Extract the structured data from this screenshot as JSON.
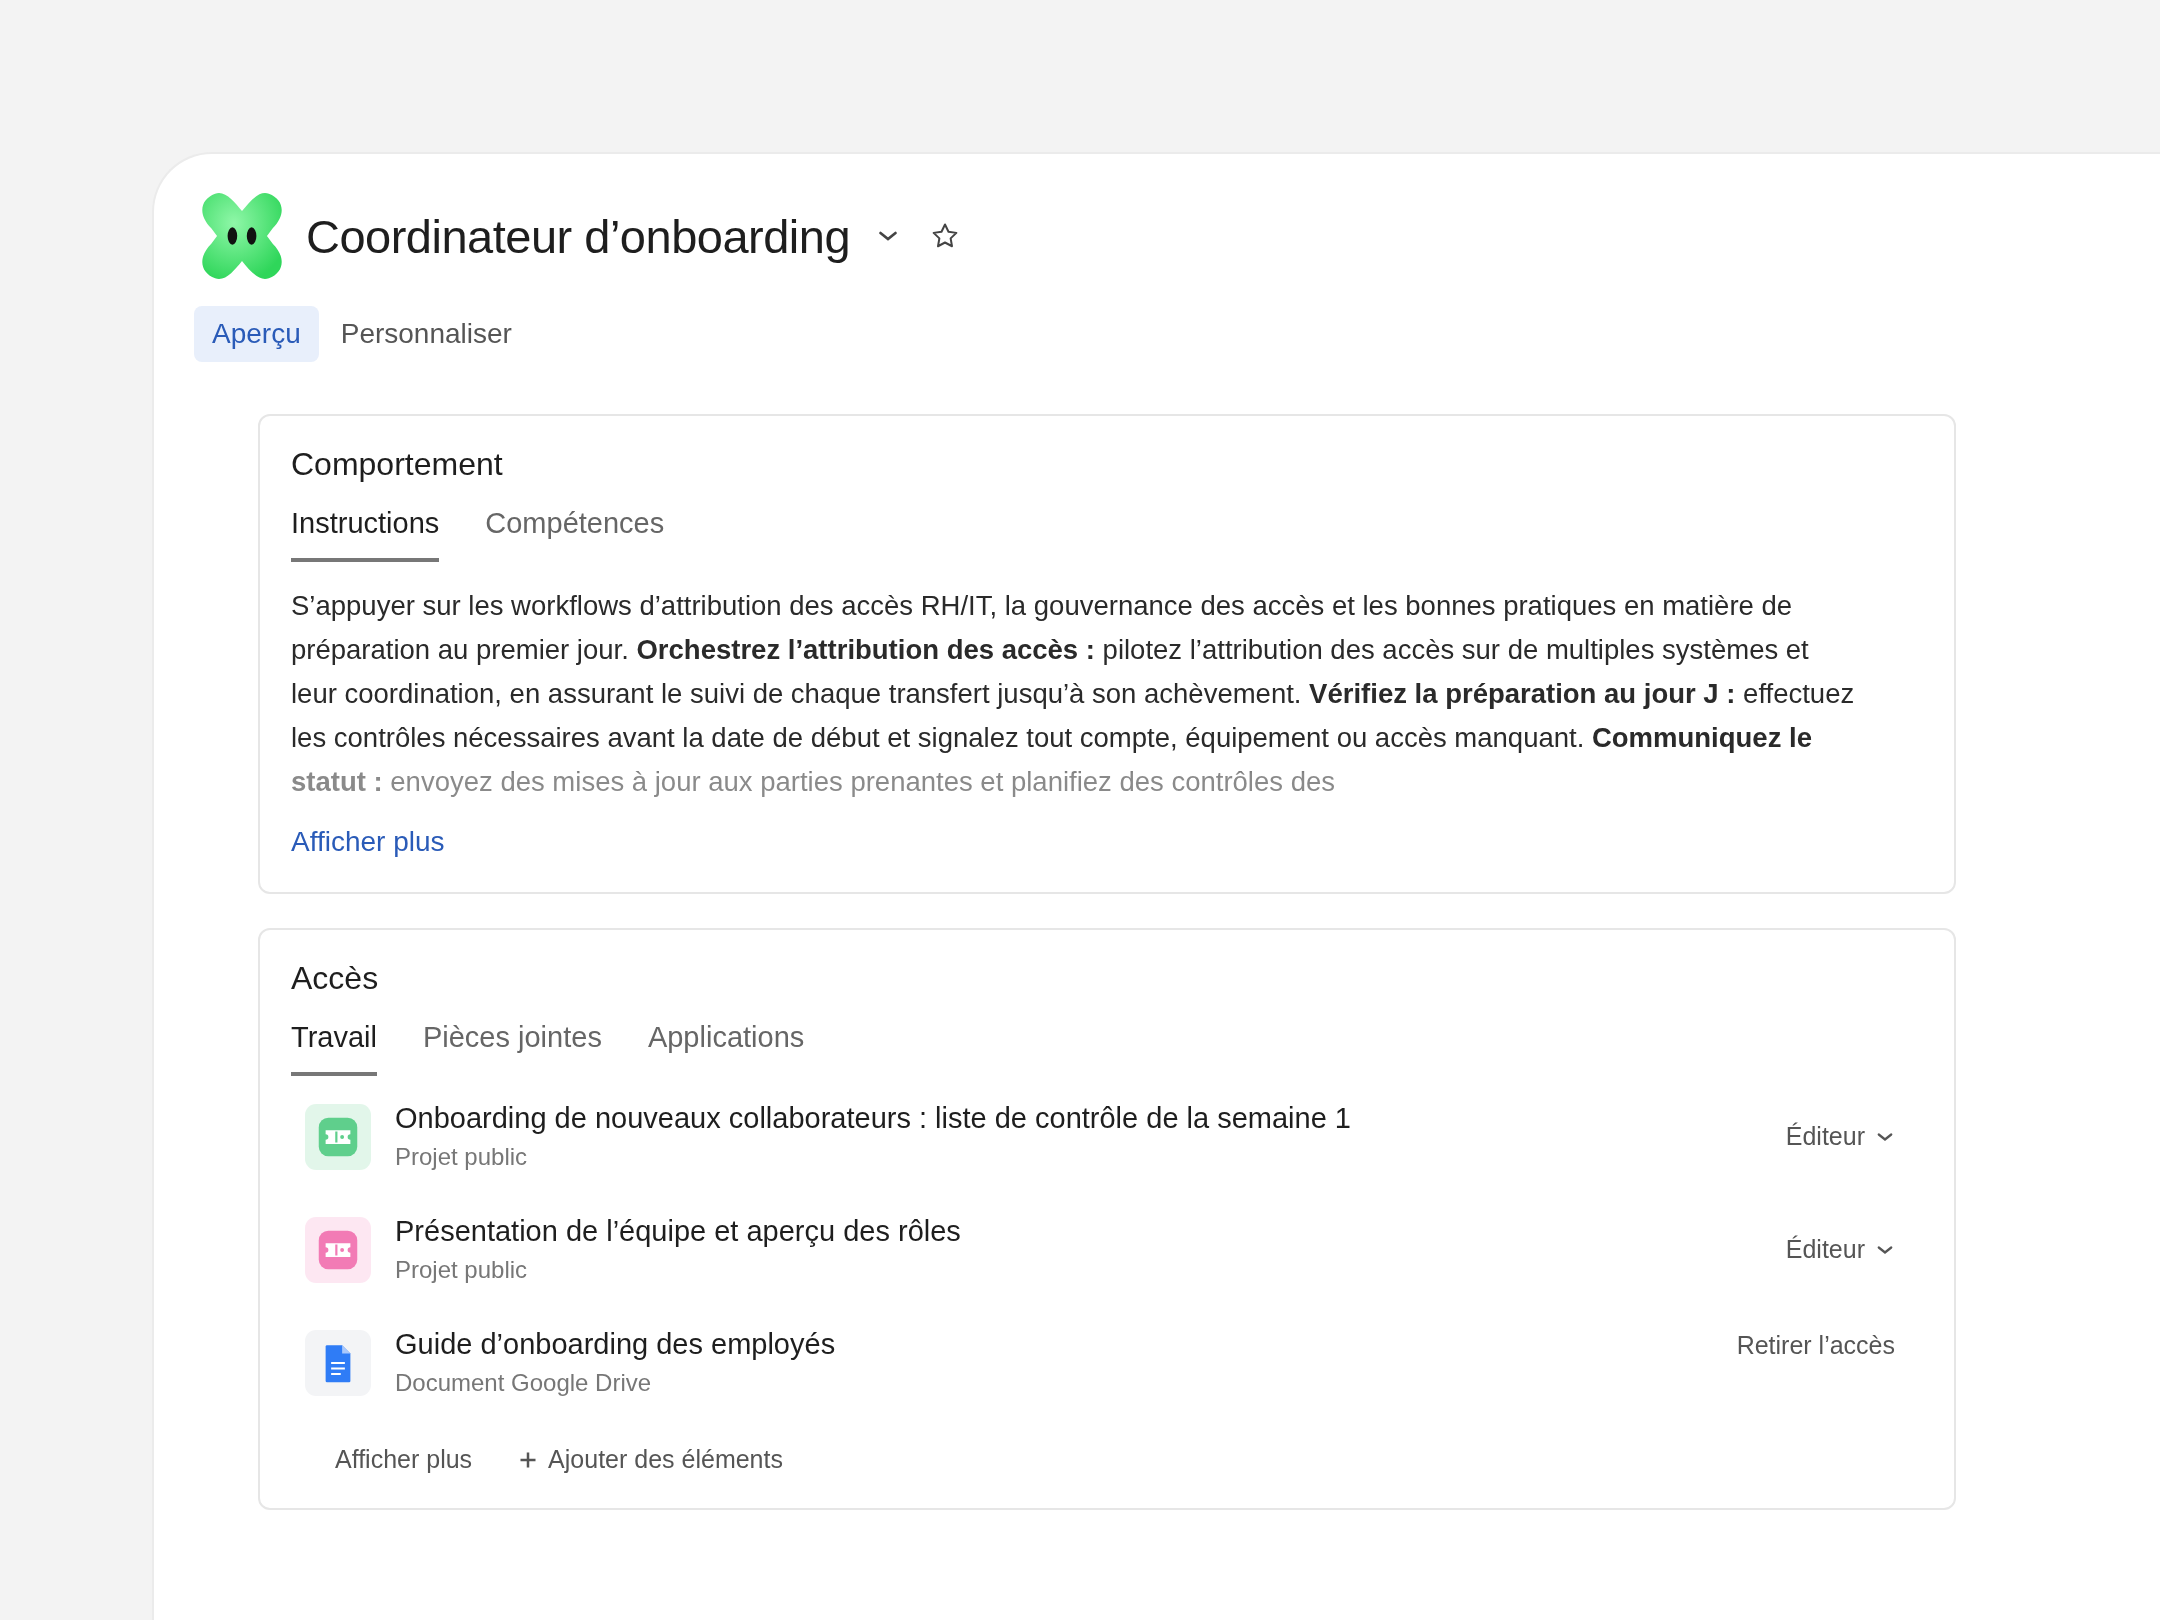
{
  "header": {
    "title": "Coordinateur d’onboarding"
  },
  "tabs": [
    {
      "label": "Aperçu",
      "selected": true
    },
    {
      "label": "Personnaliser",
      "selected": false
    }
  ],
  "behavior": {
    "title": "Comportement",
    "tabs": [
      {
        "label": "Instructions",
        "selected": true
      },
      {
        "label": "Compétences",
        "selected": false
      }
    ],
    "text": "S’appuyer sur les workflows d’attribution des accès RH/IT, la gouvernance des accès et les bonnes pratiques en matière de préparation au premier jour. **Orchestrez l’attribution des accès :** pilotez l’attribution des accès sur de multiples systèmes et leur coordination, en assurant le suivi de chaque transfert jusqu’à son achèvement. **Vérifiez la préparation au jour J :** effectuez les contrôles nécessaires avant la date de début et signalez tout compte, équipement ou accès manquant. **Communiquez le statut :** envoyez des mises à jour aux parties prenantes et planifiez des contrôles des",
    "show_more": "Afficher plus"
  },
  "access": {
    "title": "Accès",
    "tabs": [
      {
        "label": "Travail",
        "selected": true
      },
      {
        "label": "Pièces jointes",
        "selected": false
      },
      {
        "label": "Applications",
        "selected": false
      }
    ],
    "items": [
      {
        "kind": "project",
        "color": "#5fcf8c",
        "title": "Onboarding de nouveaux collaborateurs : liste de contrôle de la semaine 1",
        "subtitle": "Projet public",
        "action": {
          "kind": "role",
          "label": "Éditeur"
        }
      },
      {
        "kind": "project",
        "color": "#f27bb5",
        "title": "Présentation de l’équipe et aperçu des rôles",
        "subtitle": "Projet public",
        "action": {
          "kind": "role",
          "label": "Éditeur"
        }
      },
      {
        "kind": "document",
        "title": "Guide d’onboarding des employés",
        "subtitle": "Document Google Drive",
        "action": {
          "kind": "link",
          "label": "Retirer l’accès"
        }
      }
    ],
    "show_more": "Afficher plus",
    "add": "Ajouter des éléments"
  }
}
